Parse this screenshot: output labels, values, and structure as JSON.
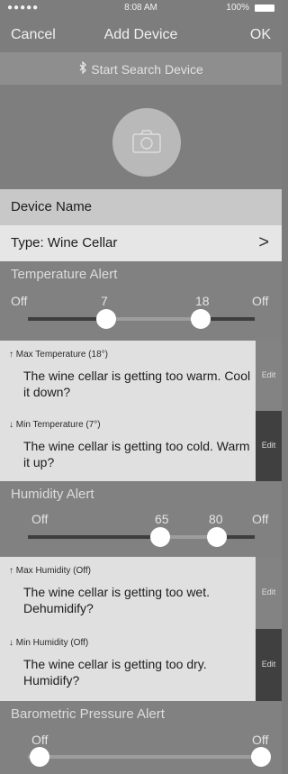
{
  "status": {
    "signal": "●●●●● ",
    "time": "8:08 AM",
    "battery": "100%"
  },
  "nav": {
    "cancel": "Cancel",
    "title": "Add Device",
    "ok": "OK"
  },
  "search": {
    "label": "Start Search Device"
  },
  "device": {
    "name_label": "Device Name",
    "type_label": "Type:  Wine Cellar"
  },
  "temperature": {
    "header": "Temperature Alert",
    "left_label": "Off",
    "low_value": "7",
    "high_value": "18",
    "right_label": "Off",
    "low": 7,
    "high": 18
  },
  "alerts": [
    {
      "small": "↑ Max Temperature (18°)",
      "text": "The wine cellar is getting too warm. Cool it down?",
      "edit": "Edit"
    },
    {
      "small": "↓ Min Temperature (7°)",
      "text": "The wine cellar is getting too cold. Warm it up?",
      "edit": "Edit"
    },
    {
      "small": "↑ Max Humidity (Off)",
      "text": "The wine cellar is getting too wet. Dehumidify?",
      "edit": "Edit"
    },
    {
      "small": "↓ Min Humidity (Off)",
      "text": "The wine cellar is getting too dry. Humidify?",
      "edit": "Edit"
    }
  ],
  "humidity": {
    "header": "Humidity Alert",
    "left_label": "Off",
    "low_value": "65",
    "high_value": "80",
    "right_label": "Off",
    "low": 65,
    "high": 80
  },
  "pressure": {
    "header": "Barometric Pressure Alert",
    "left_label": "Off",
    "right_label": "Off"
  },
  "icons": {
    "bluetooth": "bluetooth-icon",
    "camera": "camera-icon",
    "chevron": "chevron-right-icon",
    "battery": "battery-icon"
  },
  "colors": {
    "background": "#7b7b7b",
    "light_row": "#e0e0e0",
    "edit_dark": "#404040"
  }
}
